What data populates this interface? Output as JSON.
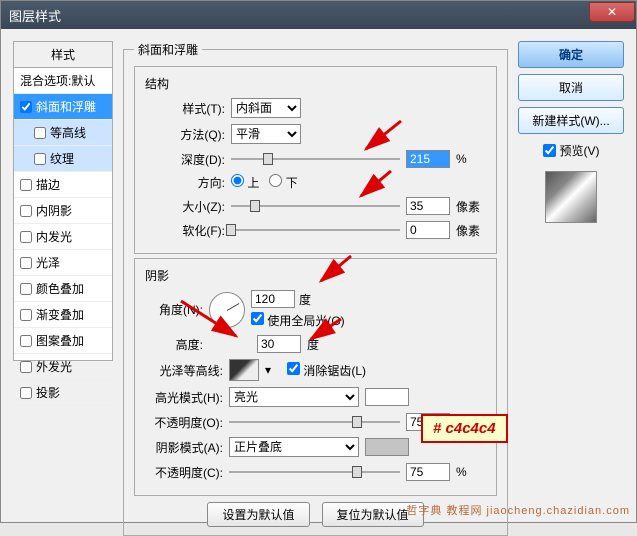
{
  "window": {
    "title": "图层样式"
  },
  "styles": {
    "header": "样式",
    "items": [
      {
        "label": "混合选项:默认",
        "checked": false,
        "type": "plain"
      },
      {
        "label": "斜面和浮雕",
        "checked": true,
        "type": "selected"
      },
      {
        "label": "等高线",
        "checked": false,
        "type": "indent"
      },
      {
        "label": "纹理",
        "checked": false,
        "type": "indent"
      },
      {
        "label": "描边",
        "checked": false,
        "type": "normal"
      },
      {
        "label": "内阴影",
        "checked": false,
        "type": "normal"
      },
      {
        "label": "内发光",
        "checked": false,
        "type": "normal"
      },
      {
        "label": "光泽",
        "checked": false,
        "type": "normal"
      },
      {
        "label": "颜色叠加",
        "checked": false,
        "type": "normal"
      },
      {
        "label": "渐变叠加",
        "checked": false,
        "type": "normal"
      },
      {
        "label": "图案叠加",
        "checked": false,
        "type": "normal"
      },
      {
        "label": "外发光",
        "checked": false,
        "type": "normal"
      },
      {
        "label": "投影",
        "checked": false,
        "type": "normal"
      }
    ]
  },
  "bevel": {
    "group": "斜面和浮雕",
    "structure": "结构",
    "style_label": "样式(T):",
    "style_value": "内斜面",
    "technique_label": "方法(Q):",
    "technique_value": "平滑",
    "depth_label": "深度(D):",
    "depth_value": "215",
    "depth_unit": "%",
    "direction_label": "方向:",
    "dir_up": "上",
    "dir_down": "下",
    "size_label": "大小(Z):",
    "size_value": "35",
    "size_unit": "像素",
    "soften_label": "软化(F):",
    "soften_value": "0",
    "soften_unit": "像素"
  },
  "shading": {
    "group": "阴影",
    "angle_label": "角度(N):",
    "angle_value": "120",
    "angle_unit": "度",
    "global_label": "使用全局光(G)",
    "altitude_label": "高度:",
    "altitude_value": "30",
    "altitude_unit": "度",
    "contour_label": "光泽等高线:",
    "antialias_label": "消除锯齿(L)",
    "highlight_mode_label": "高光模式(H):",
    "highlight_mode_value": "亮光",
    "highlight_color": "#ffffff",
    "opacity1_label": "不透明度(O):",
    "opacity1_value": "75",
    "opacity1_unit": "%",
    "shadow_mode_label": "阴影模式(A):",
    "shadow_mode_value": "正片叠底",
    "shadow_color": "#c4c4c4",
    "opacity2_label": "不透明度(C):",
    "opacity2_value": "75",
    "opacity2_unit": "%"
  },
  "buttons": {
    "default": "设置为默认值",
    "reset": "复位为默认值"
  },
  "right": {
    "ok": "确定",
    "cancel": "取消",
    "new_style": "新建样式(W)...",
    "preview": "预览(V)"
  },
  "note": "# c4c4c4",
  "watermark": "哲字典 教程网 jiaocheng.chazidian.com"
}
